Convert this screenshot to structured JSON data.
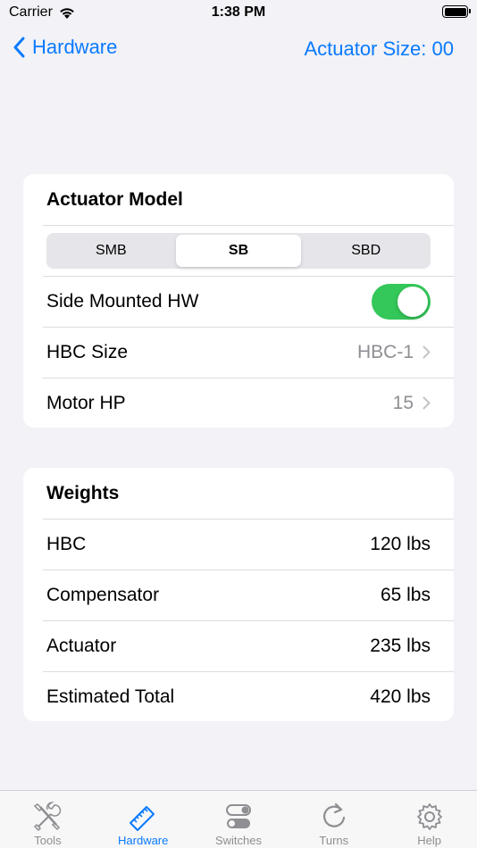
{
  "status_bar": {
    "carrier": "Carrier",
    "time": "1:38 PM"
  },
  "nav": {
    "back_label": "Hardware",
    "right_label": "Actuator Size: 00"
  },
  "actuator_card": {
    "title": "Actuator Model",
    "segments": [
      "SMB",
      "SB",
      "SBD"
    ],
    "selected_segment": "SB",
    "side_mounted": {
      "label": "Side Mounted HW",
      "on": true
    },
    "hbc_size": {
      "label": "HBC Size",
      "value": "HBC-1"
    },
    "motor_hp": {
      "label": "Motor HP",
      "value": "15"
    }
  },
  "weights_card": {
    "title": "Weights",
    "rows": [
      {
        "label": "HBC",
        "value": "120 lbs"
      },
      {
        "label": "Compensator",
        "value": "65 lbs"
      },
      {
        "label": "Actuator",
        "value": "235 lbs"
      },
      {
        "label": "Estimated Total",
        "value": "420 lbs"
      }
    ]
  },
  "tabs": [
    {
      "label": "Tools",
      "icon": "tools-icon",
      "active": false
    },
    {
      "label": "Hardware",
      "icon": "ruler-icon",
      "active": true
    },
    {
      "label": "Switches",
      "icon": "switches-icon",
      "active": false
    },
    {
      "label": "Turns",
      "icon": "turns-icon",
      "active": false
    },
    {
      "label": "Help",
      "icon": "gear-icon",
      "active": false
    }
  ],
  "colors": {
    "accent": "#0a7aff",
    "toggle_on": "#34c759",
    "background": "#f2f2f7"
  }
}
